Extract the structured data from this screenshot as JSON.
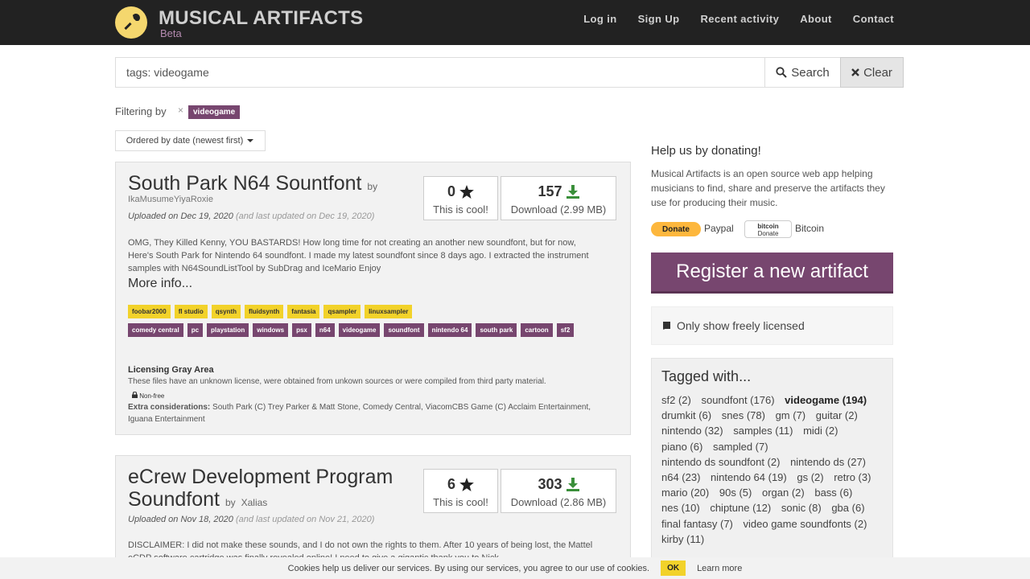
{
  "brand": {
    "title": "MUSICAL ARTIFACTS",
    "subtitle": "Beta"
  },
  "nav": [
    "Log in",
    "Sign Up",
    "Recent activity",
    "About",
    "Contact"
  ],
  "search": {
    "value": "tags: videogame",
    "search_label": "Search",
    "clear_label": "Clear"
  },
  "filter": {
    "label": "Filtering by",
    "remove": "×",
    "tag": "videogame"
  },
  "order": {
    "label": "Ordered by date (newest first)"
  },
  "artifacts": [
    {
      "title": "South Park N64 Sountfont",
      "by": "by",
      "author": "IkaMusumeYiyaRoxie",
      "uploaded": "Uploaded on Dec 19, 2020",
      "updated": "(and last updated on Dec 19, 2020)",
      "likes": "0",
      "likes_label": "This is cool!",
      "downloads": "157",
      "download_label": "Download (2.99 MB)",
      "description": "OMG, They Killed Kenny, YOU BASTARDS! How long time for not creating an another new soundfont, but for now, Here's South Park for Nintendo 64 soundfont. I made my latest soundfont since 8 days ago. I extracted the instrument samples with N64SoundListTool by SubDrag and IceMario Enjoy",
      "more": "More info...",
      "software_tags": [
        "foobar2000",
        "fl studio",
        "qsynth",
        "fluidsynth",
        "fantasia",
        "qsampler",
        "linuxsampler"
      ],
      "tags": [
        "comedy central",
        "pc",
        "playstation",
        "windows",
        "psx",
        "n64",
        "videogame",
        "soundfont",
        "nintendo 64",
        "south park",
        "cartoon",
        "sf2"
      ],
      "license_title": "Licensing Gray Area",
      "license_text": "These files have an unknown license, were obtained from unkown sources or were compiled from third party material.",
      "nonfree": "Non-free",
      "extra_label": "Extra considerations:",
      "extra_text": "South Park (C) Trey Parker & Matt Stone, Comedy Central, ViacomCBS Game (C) Acclaim Entertainment, Iguana Entertainment"
    },
    {
      "title_line1": "eCrew Development Program",
      "title_line2": "Soundfont",
      "by": "by",
      "author": "Xalias",
      "uploaded": "Uploaded on Nov 18, 2020",
      "updated": "(and last updated on Nov 21, 2020)",
      "likes": "6",
      "likes_label": "This is cool!",
      "downloads": "303",
      "download_label": "Download (2.86 MB)",
      "description": "DISCLAIMER: I did not make these sounds, and I do not own the rights to them. After 10 years of being lost, the Mattel eCDP software cartridge was finally revealed online! I need to give a gigantic thank you to Nick"
    }
  ],
  "donate": {
    "title": "Help us by donating!",
    "text": "Musical Artifacts is an open source web app helping musicians to find, share and preserve the artifacts they use for producing their music.",
    "paypal_button": "Donate",
    "paypal_label": "Paypal",
    "bitcoin_button_line1": "bitcoin",
    "bitcoin_button_line2": "Donate",
    "bitcoin_label": "Bitcoin"
  },
  "register": {
    "label": "Register a new artifact"
  },
  "free_only": {
    "label": "Only show freely licensed"
  },
  "tagged": {
    "title": "Tagged with...",
    "items": [
      {
        "label": "sf2 (2)",
        "active": false
      },
      {
        "label": "soundfont (176)",
        "active": false
      },
      {
        "label": "videogame (194)",
        "active": true
      },
      {
        "label": "drumkit (6)",
        "active": false
      },
      {
        "label": "snes (78)",
        "active": false
      },
      {
        "label": "gm (7)",
        "active": false
      },
      {
        "label": "guitar (2)",
        "active": false
      },
      {
        "label": "nintendo (32)",
        "active": false
      },
      {
        "label": "samples (11)",
        "active": false
      },
      {
        "label": "midi (2)",
        "active": false
      },
      {
        "label": "piano (6)",
        "active": false
      },
      {
        "label": "sampled (7)",
        "active": false
      },
      {
        "label": "nintendo ds soundfont (2)",
        "active": false
      },
      {
        "label": "nintendo ds (27)",
        "active": false
      },
      {
        "label": "n64 (23)",
        "active": false
      },
      {
        "label": "nintendo 64 (19)",
        "active": false
      },
      {
        "label": "gs (2)",
        "active": false
      },
      {
        "label": "retro (3)",
        "active": false
      },
      {
        "label": "mario (20)",
        "active": false
      },
      {
        "label": "90s (5)",
        "active": false
      },
      {
        "label": "organ (2)",
        "active": false
      },
      {
        "label": "bass (6)",
        "active": false
      },
      {
        "label": "nes (10)",
        "active": false
      },
      {
        "label": "chiptune (12)",
        "active": false
      },
      {
        "label": "sonic (8)",
        "active": false
      },
      {
        "label": "gba (6)",
        "active": false
      },
      {
        "label": "final fantasy (7)",
        "active": false
      },
      {
        "label": "video game soundfonts (2)",
        "active": false
      },
      {
        "label": "kirby (11)",
        "active": false
      }
    ]
  },
  "cookie": {
    "text": "Cookies help us deliver our services. By using our services, you agree to our use of cookies.",
    "ok": "OK",
    "learn": "Learn more"
  },
  "colors": {
    "topbar": "#222222",
    "accent": "#77466f",
    "tag_yellow": "#f2d22a",
    "download_green": "#3a8f3a"
  }
}
